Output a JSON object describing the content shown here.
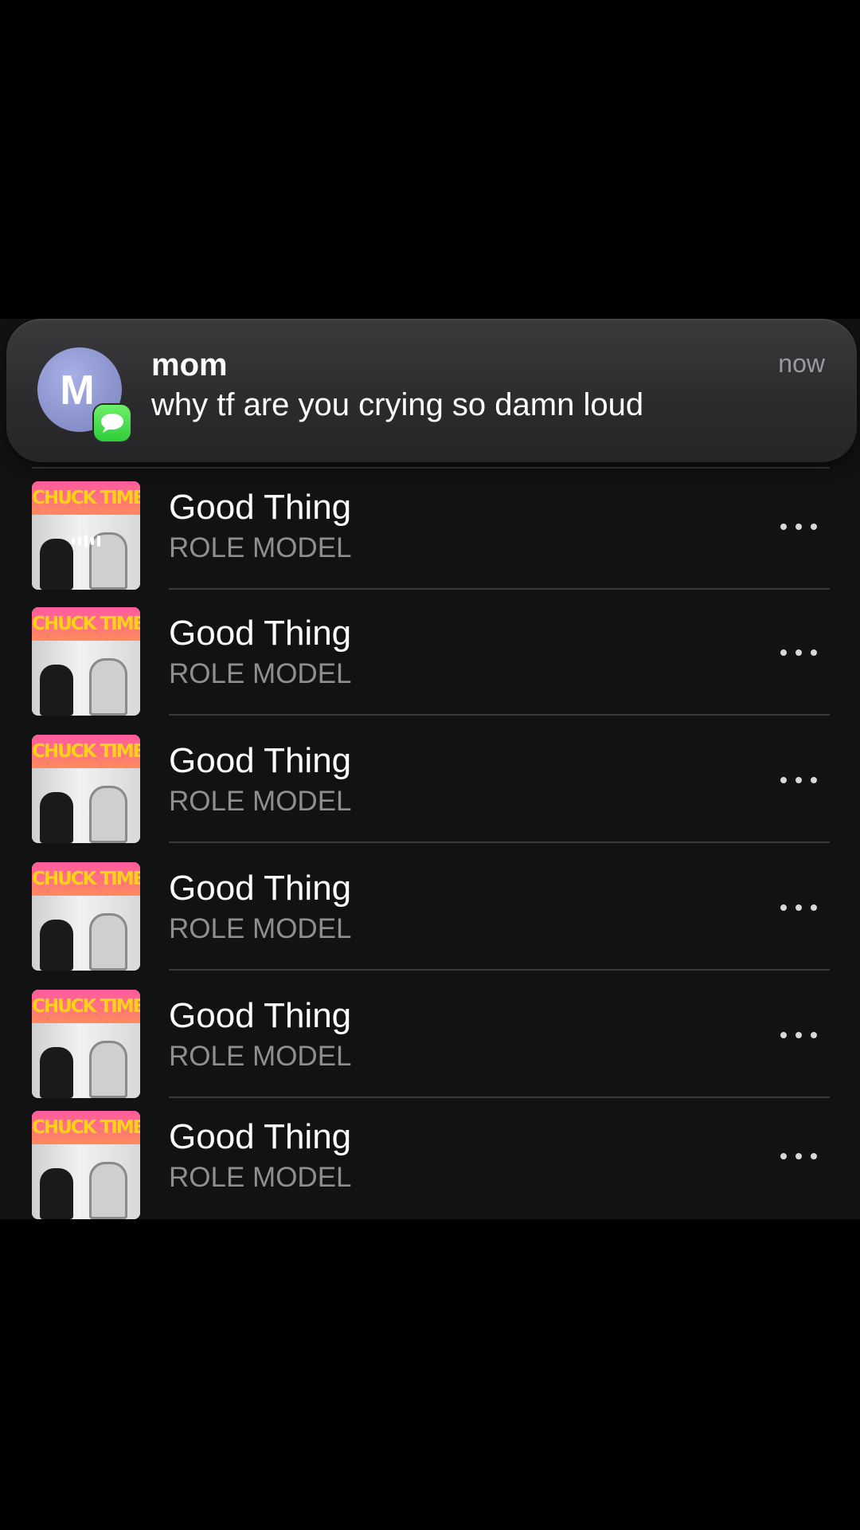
{
  "notification": {
    "avatar_letter": "M",
    "sender": "mom",
    "message": "why tf are you crying so damn loud",
    "time": "now",
    "app_icon": "messages-icon"
  },
  "album_art_text": "CHUCK TIMELY",
  "songs": [
    {
      "title": "Good Thing",
      "artist": "ROLE MODEL",
      "playing": true
    },
    {
      "title": "Good Thing",
      "artist": "ROLE MODEL",
      "playing": false
    },
    {
      "title": "Good Thing",
      "artist": "ROLE MODEL",
      "playing": false
    },
    {
      "title": "Good Thing",
      "artist": "ROLE MODEL",
      "playing": false
    },
    {
      "title": "Good Thing",
      "artist": "ROLE MODEL",
      "playing": false
    },
    {
      "title": "Good Thing",
      "artist": "ROLE MODEL",
      "playing": false
    }
  ],
  "more_icon": "ellipsis-icon"
}
